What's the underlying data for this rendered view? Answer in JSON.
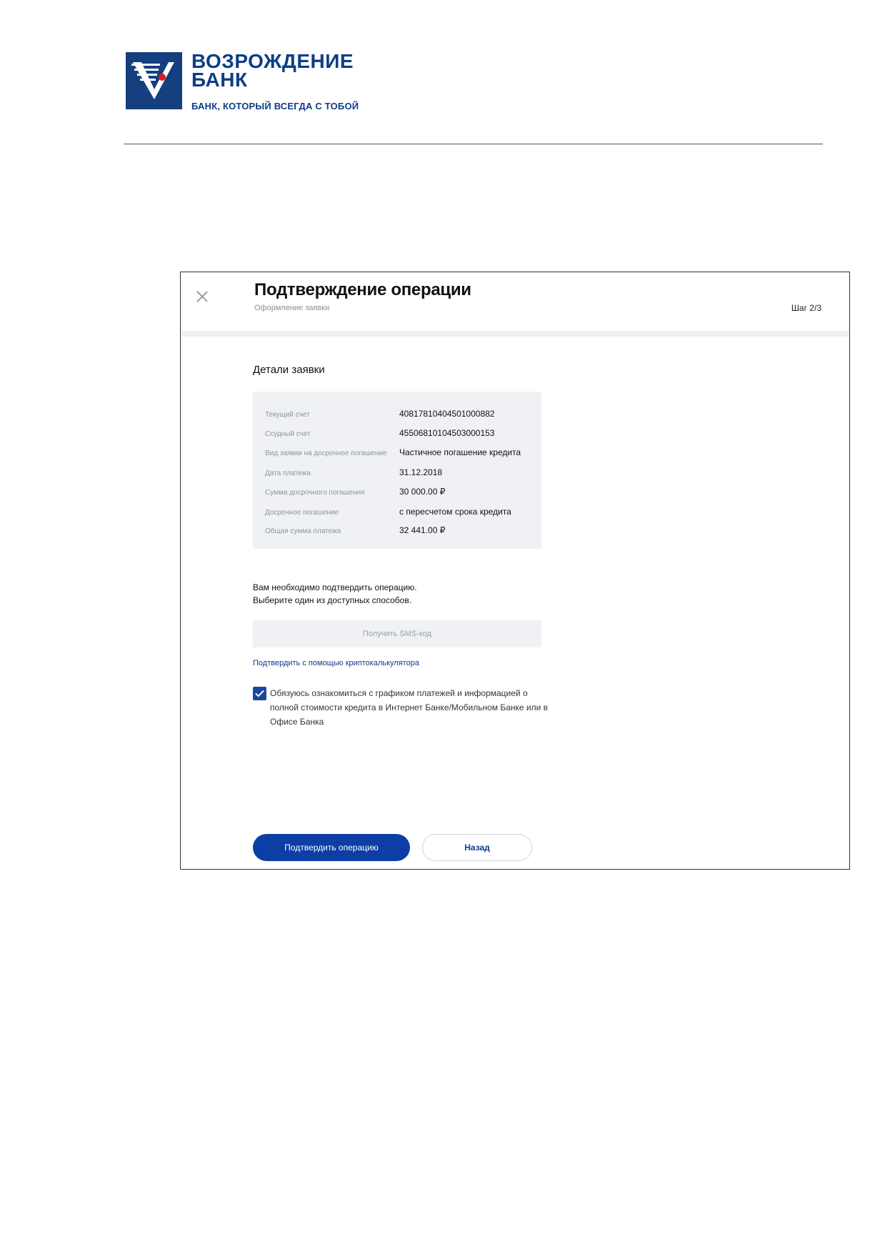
{
  "brand": {
    "name_line1": "ВОЗРОЖДЕНИЕ",
    "name_line2": "БАНК",
    "slogan": "БАНК, КОТОРЫЙ ВСЕГДА С ТОБОЙ",
    "logo_icon": "bank-v-logo-icon",
    "primary_color": "#153f7f",
    "accent_color": "#e0192a"
  },
  "dialog": {
    "title": "Подтверждение операции",
    "subtitle": "Оформление заявки",
    "step": "Шаг 2/3",
    "close_icon": "close-icon"
  },
  "details": {
    "section_title": "Детали заявки",
    "rows": [
      {
        "label": "Текущий счет",
        "value": "40817810404501000882"
      },
      {
        "label": "Ссудный счет",
        "value": "45506810104503000153"
      },
      {
        "label": "Вид заявки на досрочное погашение",
        "value": "Частичное погашение кредита"
      },
      {
        "label": "Дата платежа",
        "value": "31.12.2018"
      },
      {
        "label": "Сумма досрочного погашения",
        "value": "30 000.00 ₽"
      },
      {
        "label": "Досрочное погашение",
        "value": "с пересчетом срока кредита"
      },
      {
        "label": "Общая сумма платежа",
        "value": "32 441.00 ₽"
      }
    ]
  },
  "confirmation": {
    "notice_line1": "Вам необходимо подтвердить операцию.",
    "notice_line2": "Выберите один из доступных способов.",
    "sms_button": "Получить SMS-код",
    "crypto_link": "Подтвердить с помощью криптокалькулятора",
    "agreement_checked": true,
    "agreement_text": "Обязуюсь ознакомиться с графиком платежей и информацией о полной стоимости кредита в Интернет Банке/Мобильном Банке или в Офисе Банка"
  },
  "actions": {
    "confirm_label": "Подтвердить операцию",
    "back_label": "Назад"
  }
}
